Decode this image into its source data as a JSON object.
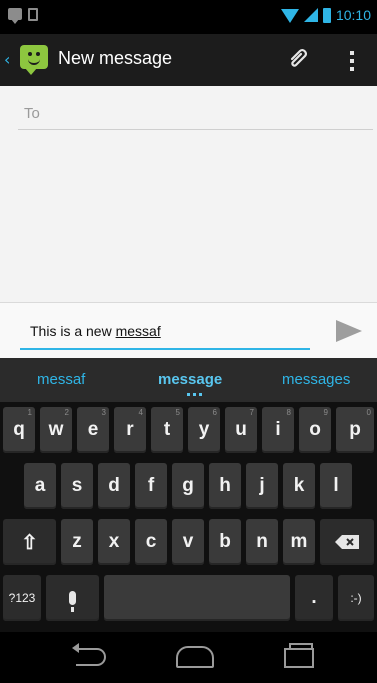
{
  "status_bar": {
    "time": "10:10",
    "icons": [
      "message-notification-icon",
      "sd-card-icon",
      "wifi-icon",
      "signal-icon",
      "battery-icon"
    ],
    "accent": "#2fb5e6"
  },
  "action_bar": {
    "title": "New message",
    "icons": [
      "up-icon",
      "messaging-app-icon",
      "attach-icon",
      "overflow-icon"
    ]
  },
  "compose": {
    "to_placeholder": "To",
    "message_prefix": "This is a new ",
    "message_composing": "messaf",
    "send_icon": "send-icon"
  },
  "suggestions": [
    "messaf",
    "message",
    "messages"
  ],
  "keyboard": {
    "row1": [
      {
        "k": "q",
        "h": "1"
      },
      {
        "k": "w",
        "h": "2"
      },
      {
        "k": "e",
        "h": "3"
      },
      {
        "k": "r",
        "h": "4"
      },
      {
        "k": "t",
        "h": "5"
      },
      {
        "k": "y",
        "h": "6"
      },
      {
        "k": "u",
        "h": "7"
      },
      {
        "k": "i",
        "h": "8"
      },
      {
        "k": "o",
        "h": "9"
      },
      {
        "k": "p",
        "h": "0"
      }
    ],
    "row2": [
      "a",
      "s",
      "d",
      "f",
      "g",
      "h",
      "j",
      "k",
      "l"
    ],
    "row3": [
      "z",
      "x",
      "c",
      "v",
      "b",
      "n",
      "m"
    ],
    "symbols_label": "?123",
    "period": ".",
    "emoticon": ":-)"
  },
  "colors": {
    "accent": "#2fb5e6",
    "app_icon": "#8dc63f",
    "key": "#3a3a3a"
  },
  "nav_bar": {
    "icons": [
      "back-icon",
      "home-icon",
      "recent-apps-icon"
    ]
  }
}
